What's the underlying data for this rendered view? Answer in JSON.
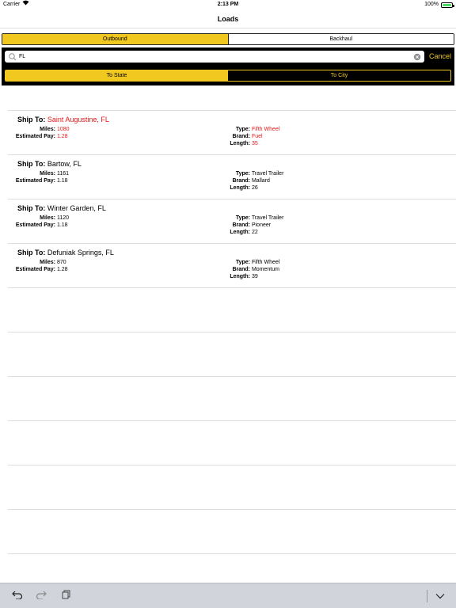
{
  "status_bar": {
    "carrier": "Carrier",
    "time": "2:13 PM",
    "battery": "100%"
  },
  "nav": {
    "title": "Loads"
  },
  "direction_tabs": [
    {
      "label": "Outbound",
      "selected": true
    },
    {
      "label": "Backhaul",
      "selected": false
    }
  ],
  "search": {
    "value": "FL",
    "placeholder": "",
    "cancel_label": "Cancel"
  },
  "filter_tabs": [
    {
      "label": "To State",
      "selected": true
    },
    {
      "label": "To City",
      "selected": false
    }
  ],
  "labels": {
    "ship_to": "Ship To:",
    "miles": "Miles:",
    "estimated_pay": "Estimated Pay:",
    "type": "Type:",
    "brand": "Brand:",
    "length": "Length:"
  },
  "loads": [
    {
      "ship_to": "Saint Augustine, FL",
      "miles": "1080",
      "estimated_pay": "1.28",
      "type": "Fifth Wheel",
      "brand": "Fuel",
      "length": "35",
      "highlighted": true
    },
    {
      "ship_to": "Bartow, FL",
      "miles": "1161",
      "estimated_pay": "1.18",
      "type": "Travel Trailer",
      "brand": "Mallard",
      "length": "26",
      "highlighted": false
    },
    {
      "ship_to": "Winter Garden, FL",
      "miles": "1120",
      "estimated_pay": "1.18",
      "type": "Travel Trailer",
      "brand": "Pioneer",
      "length": "22",
      "highlighted": false
    },
    {
      "ship_to": "Defuniak Springs, FL",
      "miles": "870",
      "estimated_pay": "1.28",
      "type": "Fifth Wheel",
      "brand": "Momentum",
      "length": "39",
      "highlighted": false
    }
  ],
  "colors": {
    "accent": "#f0c820",
    "highlight": "#e31a1a"
  }
}
